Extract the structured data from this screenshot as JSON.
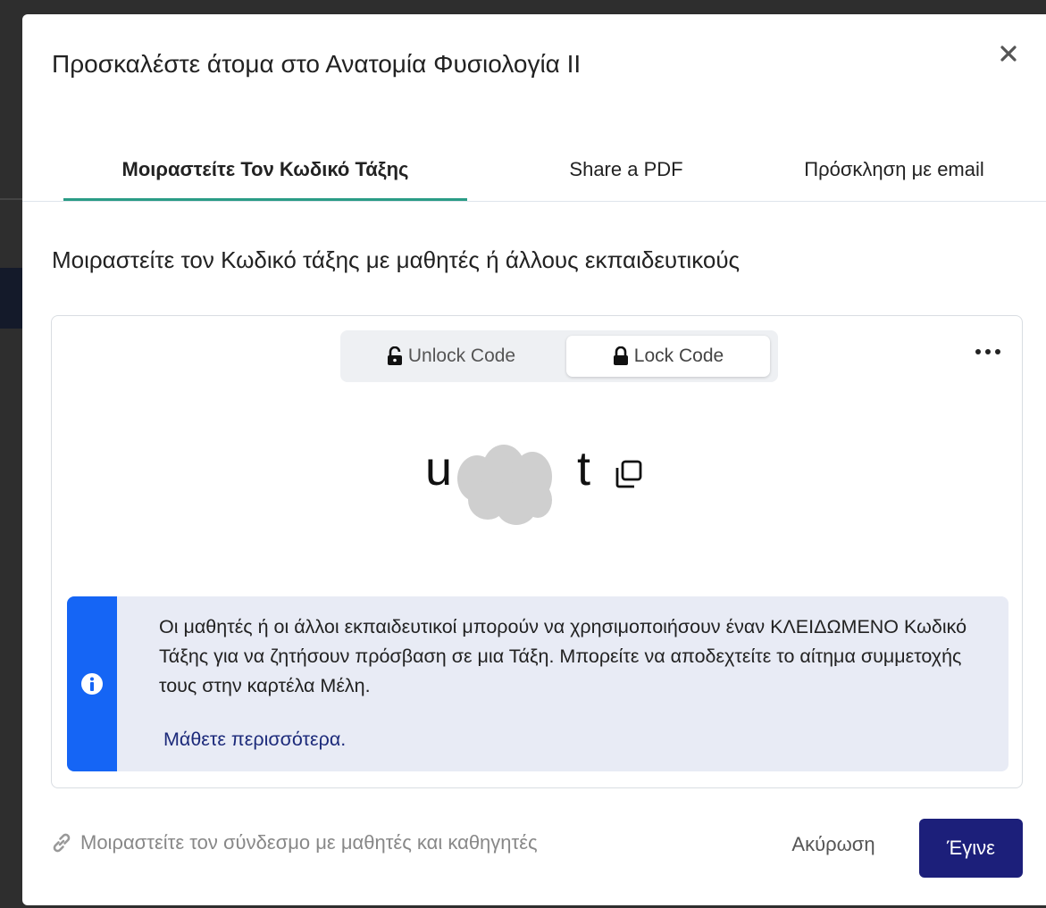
{
  "modal": {
    "title": "Προσκαλέστε άτομα στο Ανατομία Φυσιολογία ΙΙ"
  },
  "tabs": [
    {
      "label": "Μοιραστείτε Τον Κωδικό Τάξης",
      "active": true
    },
    {
      "label": "Share a PDF",
      "active": false
    },
    {
      "label": "Πρόσκληση με email",
      "active": false
    }
  ],
  "section": {
    "heading": "Μοιραστείτε τον Κωδικό τάξης με μαθητές ή άλλους εκπαιδευτικούς"
  },
  "code_toggle": {
    "unlock_label": "Unlock Code",
    "lock_label": "Lock Code",
    "selected": "lock"
  },
  "class_code": {
    "visible_start": "u",
    "visible_end": "t"
  },
  "info": {
    "text": "Οι μαθητές ή οι άλλοι εκπαιδευτικοί μπορούν να χρησιμοποιήσουν έναν ΚΛΕΙΔΩΜΕΝΟ Κωδικό Τάξης για να ζητήσουν πρόσβαση σε μια Τάξη. Μπορείτε να αποδεχτείτε το αίτημα συμμετοχής τους στην καρτέλα Μέλη.",
    "link": "Μάθετε περισσότερα."
  },
  "footer": {
    "share_link": "Μοιραστείτε τον σύνδεσμο με μαθητές και καθηγητές",
    "cancel": "Ακύρωση",
    "done": "Έγινε"
  },
  "colors": {
    "accent_tab": "#2a9c86",
    "info_stripe": "#1565f5",
    "done_button": "#1c1f7a"
  }
}
